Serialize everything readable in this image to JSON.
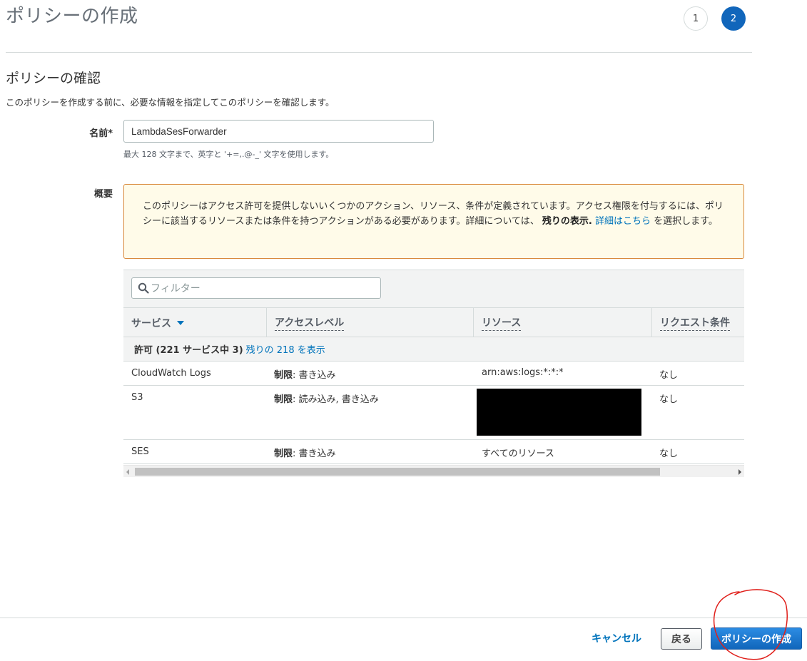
{
  "header": {
    "title": "ポリシーの作成",
    "steps": [
      "1",
      "2"
    ],
    "active_step": 2
  },
  "review": {
    "title": "ポリシーの確認",
    "description": "このポリシーを作成する前に、必要な情報を指定してこのポリシーを確認します。"
  },
  "name_field": {
    "label": "名前*",
    "value": "LambdaSesForwarder",
    "hint": "最大 128 文字まで、英字と '+=,.@-_' 文字を使用します。"
  },
  "summary": {
    "label": "概要",
    "warning_text": "このポリシーはアクセス許可を提供しないいくつかのアクション、リソース、条件が定義されています。アクセス権限を付与するには、ポリシーに該当するリソースまたは条件を持つアクションがある必要があります。詳細については、",
    "warning_bold": "残りの表示.",
    "warning_link": "詳細はこちら",
    "warning_tail": "を選択します。"
  },
  "table": {
    "filter_placeholder": "フィルター",
    "columns": [
      "サービス",
      "アクセスレベル",
      "リソース",
      "リクエスト条件"
    ],
    "group": {
      "label": "許可 (221 サービス中 3)",
      "link": "残りの 218 を表示"
    },
    "rows": [
      {
        "service": "CloudWatch Logs",
        "level_bold": "制限",
        "level_rest": ": 書き込み",
        "resource": "arn:aws:logs:*:*:*",
        "condition": "なし"
      },
      {
        "service": "S3",
        "level_bold": "制限",
        "level_rest": ": 読み込み, 書き込み",
        "resource": "",
        "condition": "なし"
      },
      {
        "service": "SES",
        "level_bold": "制限",
        "level_rest": ": 書き込み",
        "resource": "すべてのリソース",
        "condition": "なし"
      }
    ]
  },
  "footer": {
    "cancel": "キャンセル",
    "back": "戻る",
    "create": "ポリシーの作成"
  },
  "colors": {
    "primary": "#1166bb",
    "link": "#0073bb",
    "warning_border": "#d98a3c",
    "warning_bg": "#fffbe9",
    "annotation": "#e0201b"
  }
}
